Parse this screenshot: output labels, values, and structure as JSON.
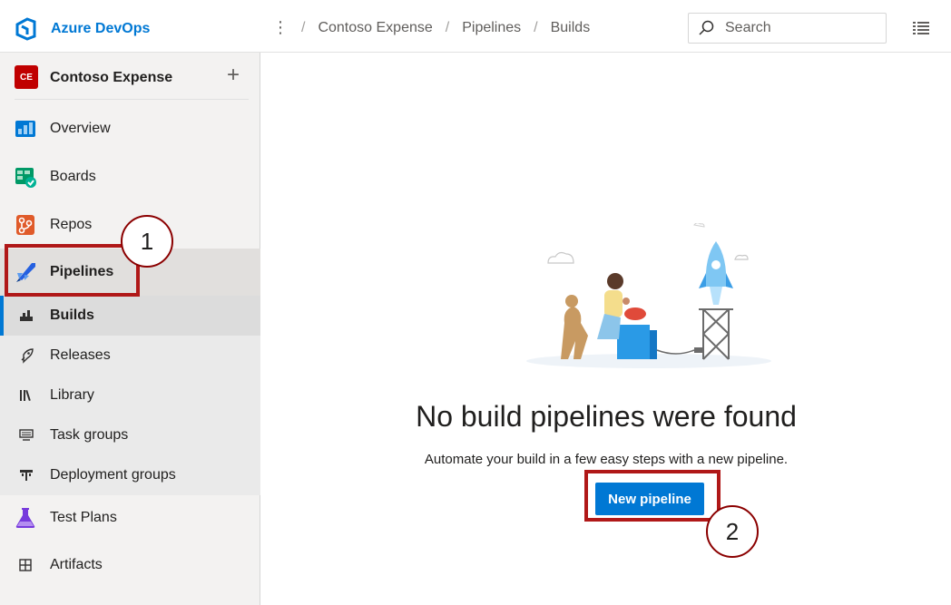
{
  "app": {
    "name": "Azure DevOps"
  },
  "breadcrumb": [
    "Contoso Expense",
    "Pipelines",
    "Builds"
  ],
  "search": {
    "placeholder": "Search"
  },
  "project": {
    "initials": "CE",
    "name": "Contoso Expense"
  },
  "nav": {
    "overview": "Overview",
    "boards": "Boards",
    "repos": "Repos",
    "pipelines": "Pipelines",
    "builds": "Builds",
    "releases": "Releases",
    "library": "Library",
    "task_groups": "Task groups",
    "deployment_groups": "Deployment groups",
    "test_plans": "Test Plans",
    "artifacts": "Artifacts"
  },
  "empty_state": {
    "title": "No build pipelines were found",
    "subtitle": "Automate your build in a few easy steps with a new pipeline.",
    "button": "New pipeline"
  },
  "callouts": [
    "1",
    "2"
  ],
  "colors": {
    "accent": "#0078d4",
    "callout": "#b01818",
    "project_badge": "#c00000"
  }
}
